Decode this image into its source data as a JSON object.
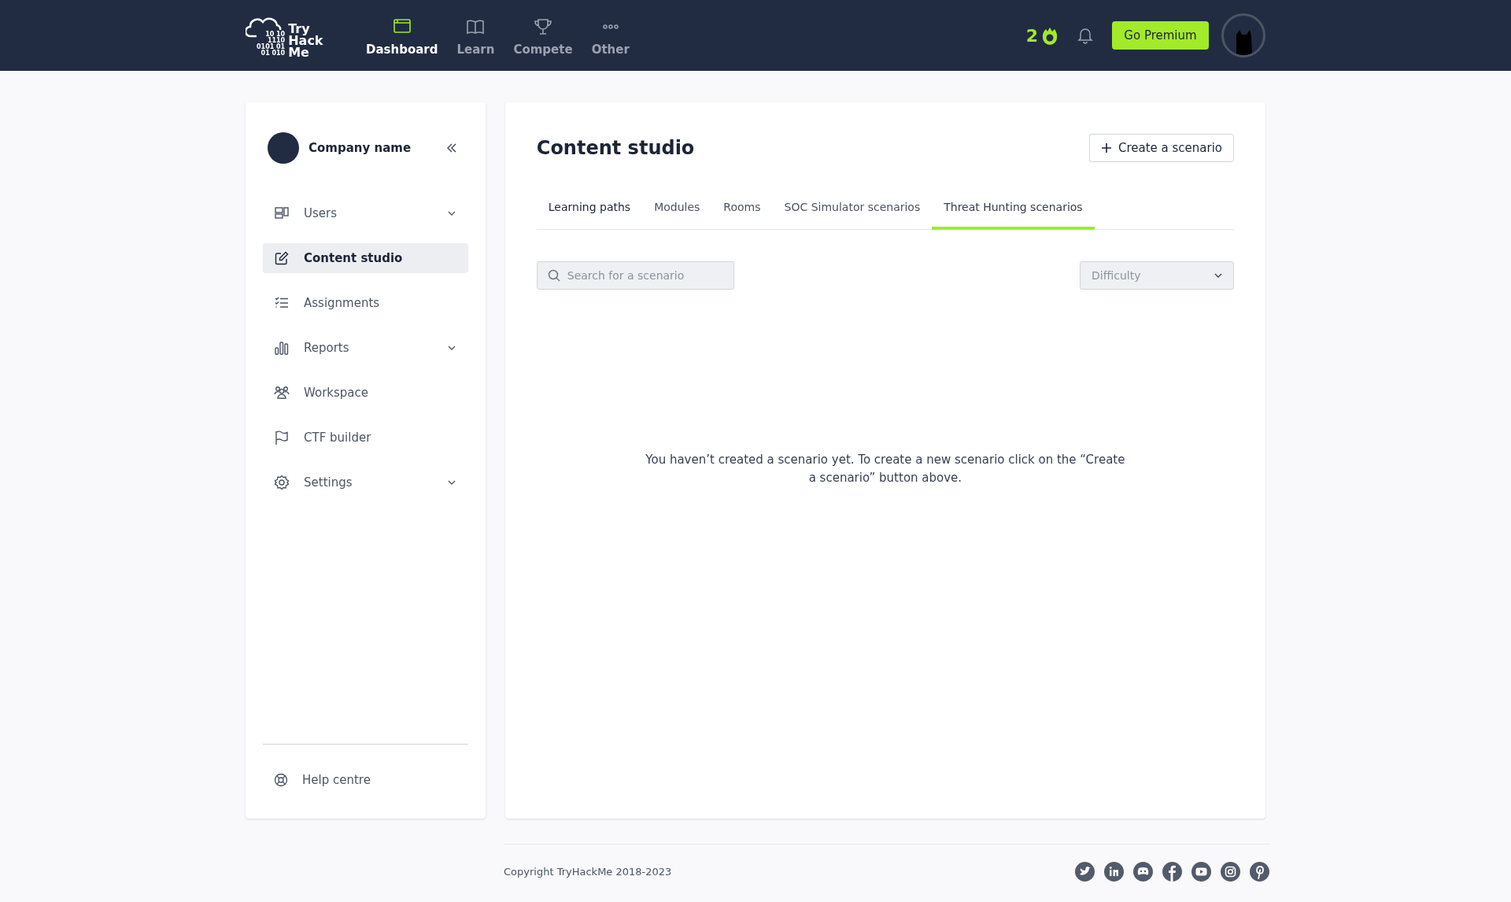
{
  "header": {
    "logo": {
      "lines": [
        "Try",
        "Hack",
        "Me"
      ],
      "digits": [
        "10 10",
        "1110",
        "0101 01",
        "01 010"
      ]
    },
    "nav": [
      {
        "label": "Dashboard",
        "selected": true
      },
      {
        "label": "Learn",
        "selected": false
      },
      {
        "label": "Compete",
        "selected": false
      },
      {
        "label": "Other",
        "selected": false
      }
    ],
    "streak": "2",
    "premium_button": "Go Premium"
  },
  "sidebar": {
    "company": "Company name",
    "items": [
      {
        "label": "Users",
        "selected": false,
        "expandable": true
      },
      {
        "label": "Content studio",
        "selected": true,
        "expandable": false
      },
      {
        "label": "Assignments",
        "selected": false,
        "expandable": false
      },
      {
        "label": "Reports",
        "selected": false,
        "expandable": true
      },
      {
        "label": "Workspace",
        "selected": false,
        "expandable": false
      },
      {
        "label": "CTF builder",
        "selected": false,
        "expandable": false
      },
      {
        "label": "Settings",
        "selected": false,
        "expandable": true
      }
    ],
    "help": "Help centre"
  },
  "main": {
    "title": "Content studio",
    "create_button": "Create a scenario",
    "tabs": [
      {
        "label": "Learning paths",
        "selected": false
      },
      {
        "label": "Modules",
        "selected": false
      },
      {
        "label": "Rooms",
        "selected": false
      },
      {
        "label": "SOC Simulator scenarios",
        "selected": false
      },
      {
        "label": "Threat Hunting scenarios",
        "selected": true
      }
    ],
    "search": {
      "placeholder": "Search for a scenario"
    },
    "difficulty": {
      "placeholder": "Difficulty"
    },
    "empty_message": "You haven’t created a scenario yet. To create a new scenario click on the “Create a scenario” button above."
  },
  "footer": {
    "copyright": "Copyright TryHackMe 2018-2023"
  }
}
